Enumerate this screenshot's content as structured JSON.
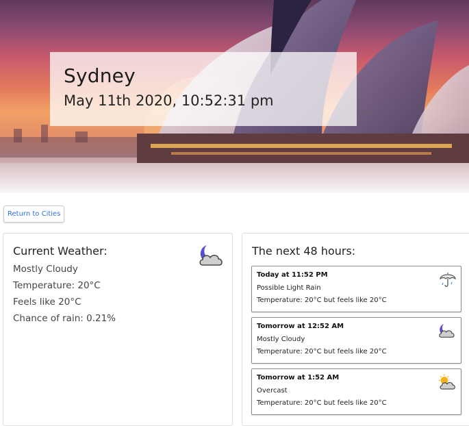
{
  "city": {
    "name": "Sydney",
    "datetime": "May 11th 2020, 10:52:31 pm"
  },
  "nav": {
    "return_label": "Return to Cities"
  },
  "current": {
    "heading": "Current Weather:",
    "summary": "Mostly Cloudy",
    "temperature": "Temperature: 20°C",
    "feels_like": "Feels like 20°C",
    "rain_chance": "Chance of rain: 0.21%",
    "icon": "partly-cloudy-night-icon"
  },
  "forecast": {
    "heading": "The next 48 hours:",
    "items": [
      {
        "time": "Today at 11:52 PM",
        "summary": "Possible Light Rain",
        "temp": "Temperature: 20°C but feels like 20°C",
        "icon": "umbrella-icon"
      },
      {
        "time": "Tomorrow at 12:52 AM",
        "summary": "Mostly Cloudy",
        "temp": "Temperature: 20°C but feels like 20°C",
        "icon": "partly-cloudy-night-icon"
      },
      {
        "time": "Tomorrow at 1:52 AM",
        "summary": "Overcast",
        "temp": "Temperature: 20°C but feels like 20°C",
        "icon": "partly-cloudy-day-icon"
      }
    ]
  },
  "colors": {
    "link_blue": "#2f6fdb",
    "moon_purple": "#5b4fd1",
    "sun_yellow": "#f2b21b"
  }
}
